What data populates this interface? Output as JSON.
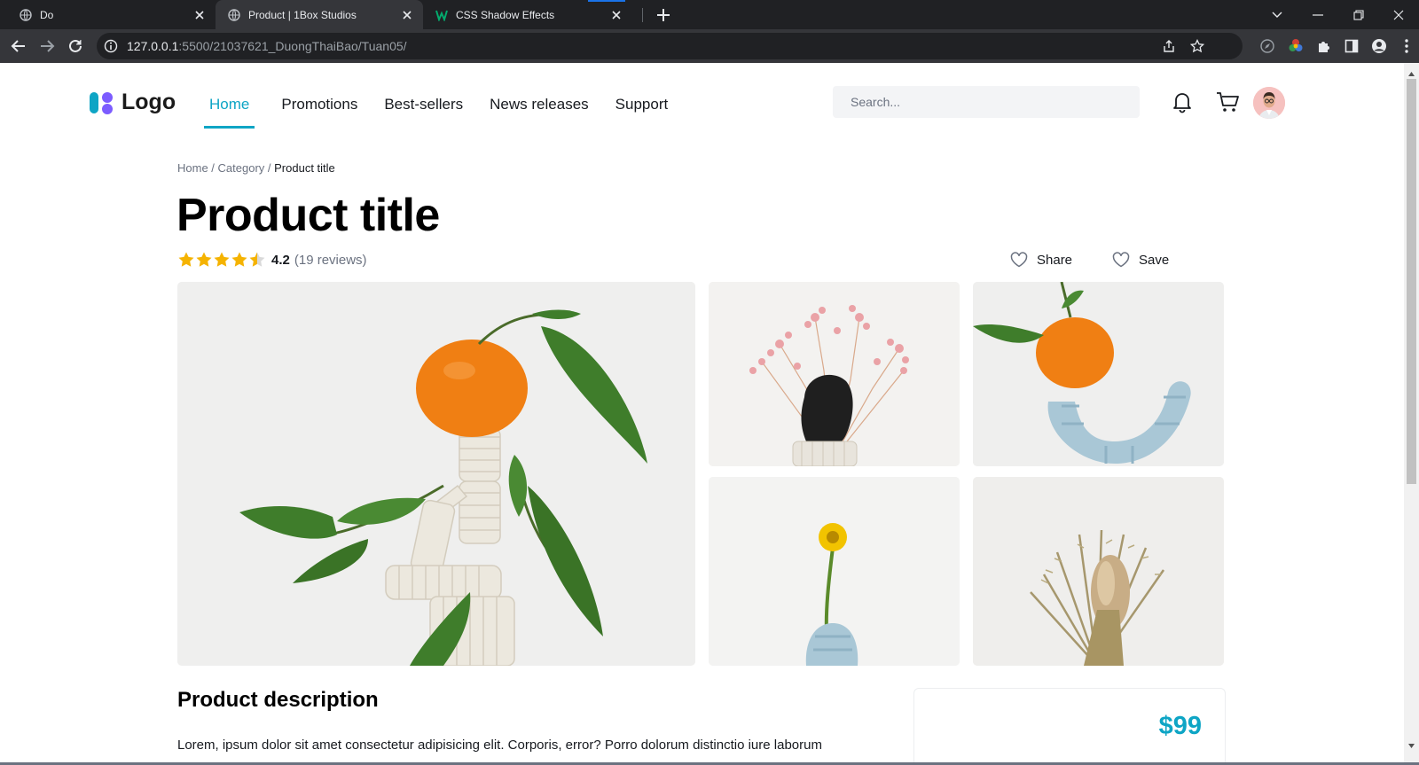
{
  "browser": {
    "tabs": [
      {
        "title": "Do",
        "active": false
      },
      {
        "title": "Product | 1Box Studios",
        "active": true
      },
      {
        "title": "CSS Shadow Effects",
        "active": false
      }
    ],
    "url_host": "127.0.0.1",
    "url_rest": ":5500/21037621_DuongThaiBao/Tuan05/"
  },
  "header": {
    "logo_text": "Logo",
    "nav": [
      "Home",
      "Promotions",
      "Best-sellers",
      "News releases",
      "Support"
    ],
    "active_nav": "Home",
    "search_placeholder": "Search..."
  },
  "breadcrumb": {
    "home": "Home",
    "sep1": " / ",
    "category": "Category",
    "sep2": " / ",
    "current": "Product title"
  },
  "product": {
    "title": "Product title",
    "rating": 4.2,
    "rating_label": "4.2",
    "reviews_label": "(19 reviews)",
    "share_label": "Share",
    "save_label": "Save",
    "description_title": "Product description",
    "description_text": "Lorem, ipsum dolor sit amet consectetur adipisicing elit. Corporis, error? Porro dolorum distinctio iure laborum",
    "price": "$99"
  },
  "colors": {
    "accent": "#0ea5c5",
    "star": "#f5b301",
    "tangerine": "#f07f13",
    "leaf": "#3f7d2b"
  },
  "icons": [
    "bell-icon",
    "cart-icon",
    "heart-icon",
    "star-icon",
    "chevron-down-icon"
  ]
}
